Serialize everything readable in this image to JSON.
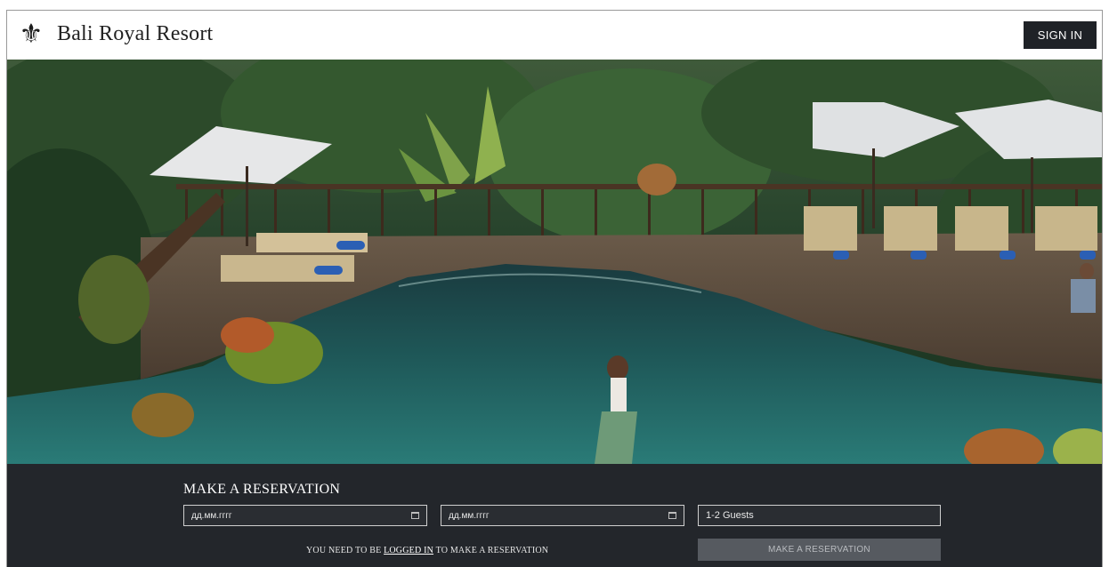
{
  "header": {
    "logo_icon": "fleur-de-lis-icon",
    "logo_glyph": "⚜",
    "brand": "Bali Royal Resort",
    "signin_label": "SIGN IN"
  },
  "hero": {
    "image": "resort-infinity-pool-photo"
  },
  "reservation": {
    "title": "MAKE A RESERVATION",
    "checkin_placeholder": "дд.мм.гггг",
    "checkout_placeholder": "дд.мм.гггг",
    "guests_value": "1-2 Guests",
    "notice_before": "YOU NEED TO BE ",
    "notice_link": "LOGGED IN",
    "notice_after": " TO MAKE A RESERVATION",
    "button_label": "MAKE A RESERVATION"
  },
  "colors": {
    "header_button_bg": "#1f2227",
    "reservation_bg": "#23262b",
    "disabled_button_bg": "#565a60"
  }
}
